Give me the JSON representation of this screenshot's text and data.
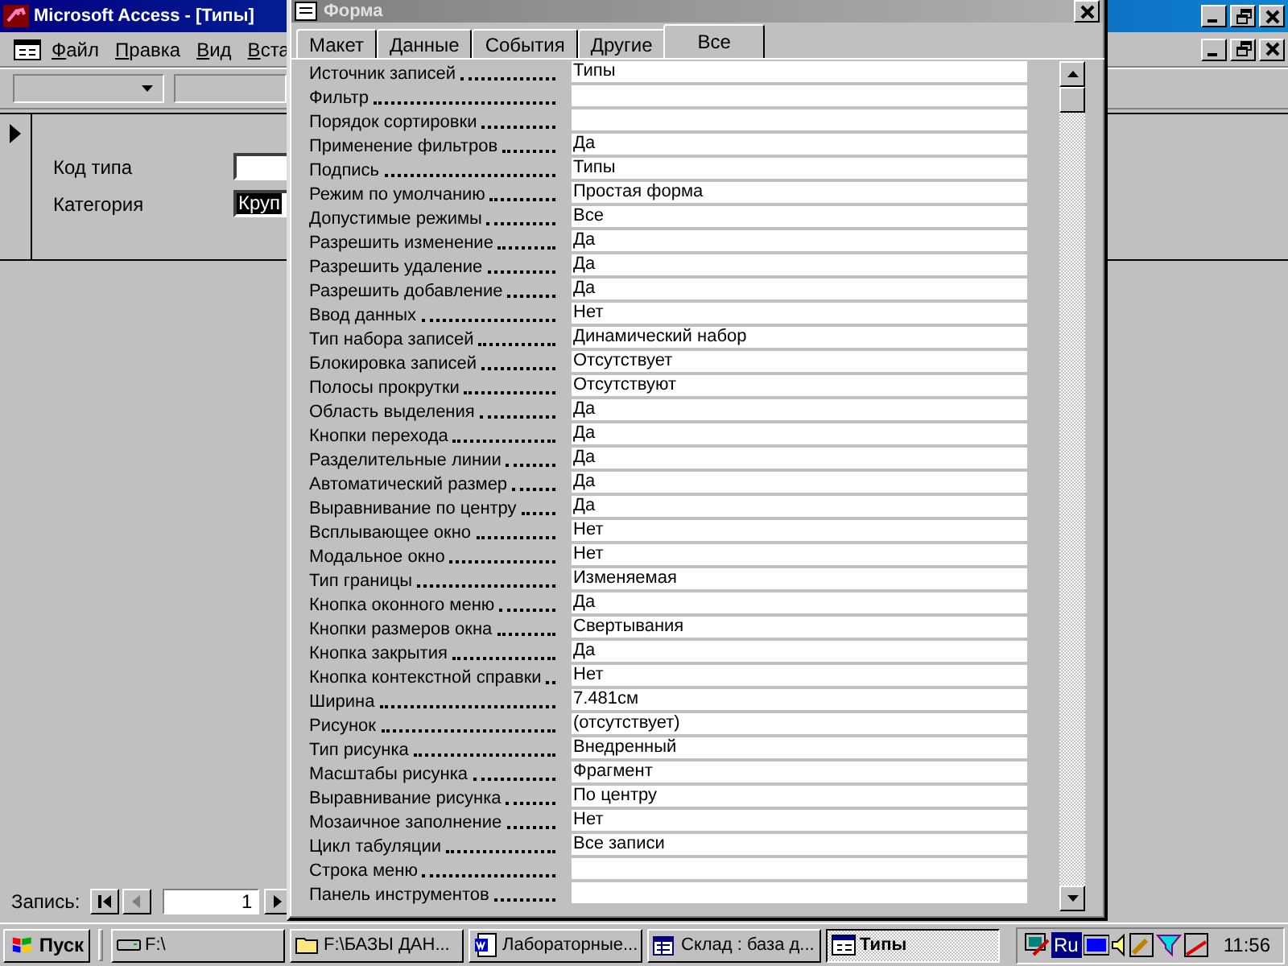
{
  "access_window": {
    "title": "Microsoft Access - [Типы]",
    "menu": [
      "Файл",
      "Правка",
      "Вид",
      "Вста"
    ],
    "form_fields": [
      {
        "label": "Код типа"
      },
      {
        "label": "Категория",
        "value": "Круп",
        "selected": true
      }
    ],
    "record_nav": {
      "label": "Запись:",
      "value": "1"
    }
  },
  "property_sheet": {
    "title": "Форма",
    "tabs": [
      {
        "label": "Макет",
        "selected": false
      },
      {
        "label": "Данные",
        "selected": false
      },
      {
        "label": "События",
        "selected": false
      },
      {
        "label": "Другие",
        "selected": false
      },
      {
        "label": "Все",
        "selected": true
      }
    ],
    "properties": [
      {
        "name": "Источник записей",
        "value": "Типы"
      },
      {
        "name": "Фильтр"
      },
      {
        "name": "Порядок сортировки"
      },
      {
        "name": "Применение фильтров",
        "value": "Да"
      },
      {
        "name": "Подпись",
        "value": "Типы"
      },
      {
        "name": "Режим по умолчанию",
        "value": "Простая форма"
      },
      {
        "name": "Допустимые режимы",
        "value": "Все"
      },
      {
        "name": "Разрешить изменение",
        "value": "Да"
      },
      {
        "name": "Разрешить удаление",
        "value": "Да"
      },
      {
        "name": "Разрешить добавление",
        "value": "Да"
      },
      {
        "name": "Ввод данных",
        "value": "Нет"
      },
      {
        "name": "Тип набора записей",
        "value": "Динамический набор"
      },
      {
        "name": "Блокировка записей",
        "value": "Отсутствует"
      },
      {
        "name": "Полосы прокрутки",
        "value": "Отсутствуют"
      },
      {
        "name": "Область выделения",
        "value": "Да"
      },
      {
        "name": "Кнопки перехода",
        "value": "Да"
      },
      {
        "name": "Разделительные линии",
        "value": "Да"
      },
      {
        "name": "Автоматический размер",
        "value": "Да"
      },
      {
        "name": "Выравнивание по центру",
        "value": "Да"
      },
      {
        "name": "Всплывающее окно",
        "value": "Нет"
      },
      {
        "name": "Модальное окно",
        "value": "Нет"
      },
      {
        "name": "Тип границы",
        "value": "Изменяемая"
      },
      {
        "name": "Кнопка оконного меню",
        "value": "Да"
      },
      {
        "name": "Кнопки размеров окна",
        "value": "Свертывания"
      },
      {
        "name": "Кнопка закрытия",
        "value": "Да"
      },
      {
        "name": "Кнопка контекстной справки",
        "value": "Нет"
      },
      {
        "name": "Ширина",
        "value": "7.481см"
      },
      {
        "name": "Рисунок",
        "value": "(отсутствует)"
      },
      {
        "name": "Тип рисунка",
        "value": "Внедренный"
      },
      {
        "name": "Масштабы рисунка",
        "value": "Фрагмент"
      },
      {
        "name": "Выравнивание рисунка",
        "value": "По центру"
      },
      {
        "name": "Мозаичное заполнение",
        "value": "Нет"
      },
      {
        "name": "Цикл табуляции",
        "value": "Все записи"
      },
      {
        "name": "Строка меню"
      },
      {
        "name": "Панель инструментов"
      }
    ]
  },
  "taskbar": {
    "start": "Пуск",
    "tasks": [
      {
        "label": "F:\\",
        "kind": "drive",
        "selected": false
      },
      {
        "label": "F:\\БАЗЫ ДАН...",
        "kind": "folder",
        "selected": false
      },
      {
        "label": "Лабораторные...",
        "kind": "document",
        "selected": false
      },
      {
        "label": "Склад : база д...",
        "kind": "database",
        "selected": false
      },
      {
        "label": "Типы",
        "kind": "form",
        "selected": true
      }
    ],
    "tray": {
      "language": "Ru",
      "clock": "11:56"
    }
  }
}
